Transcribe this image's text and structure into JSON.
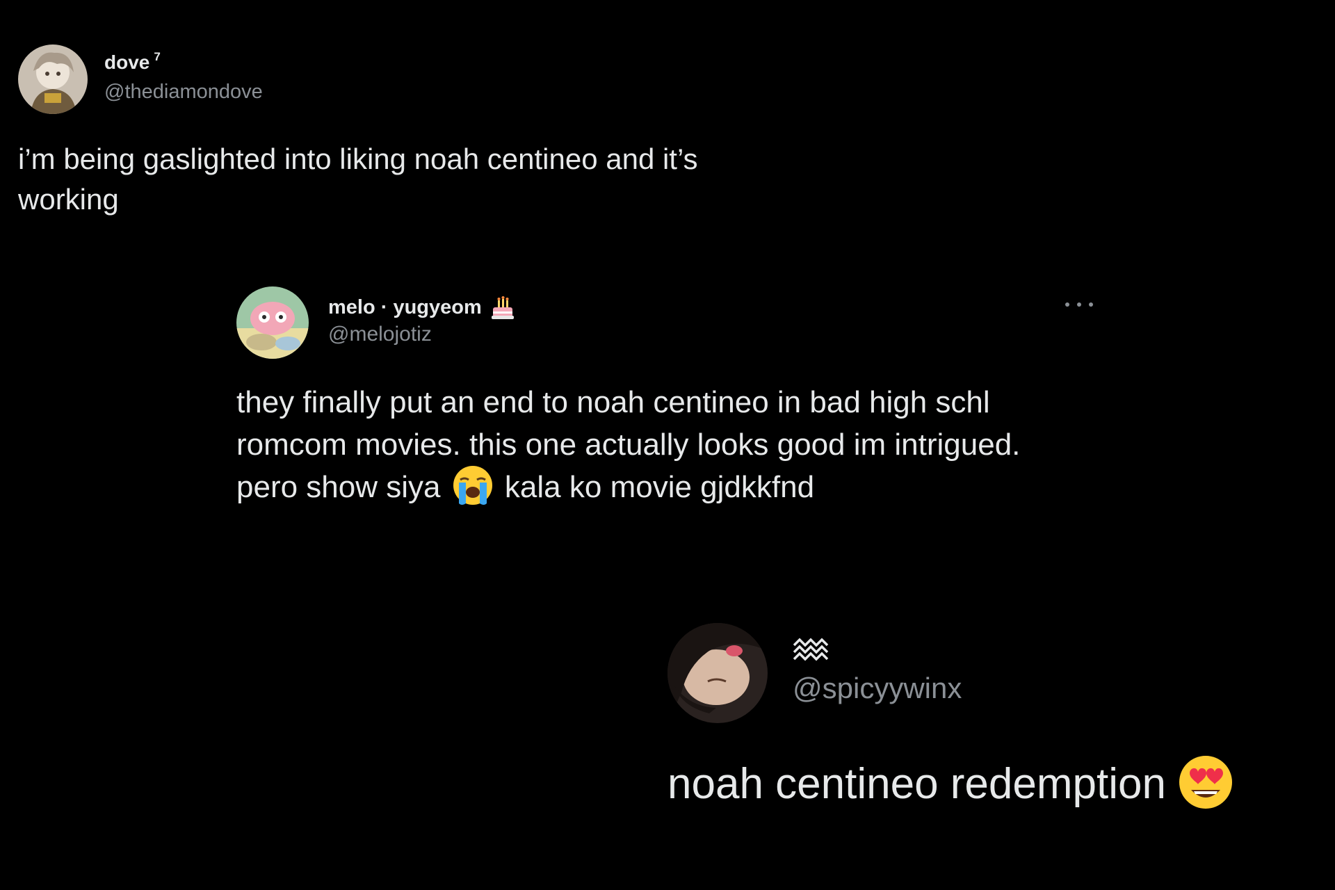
{
  "tweets": [
    {
      "display_name": "dove",
      "name_suffix": "7",
      "handle": "@thediamondove",
      "text": "i’m being gaslighted into liking noah centineo and it’s working"
    },
    {
      "display_name": "melo · yugyeom",
      "name_icon": "birthday-cake-icon",
      "handle": "@melojotiz",
      "text_before_emoji": "they finally put an end to noah centineo in bad high schl romcom movies. this one actually looks good im intrigued. pero show siya ",
      "emoji": "loudly-crying-face-icon",
      "text_after_emoji": " kala ko movie gjdkkfnd",
      "menu_icon": "more-options-icon"
    },
    {
      "name_icon": "aquarius-symbol-icon",
      "handle": "@spicyywinx",
      "text": "noah centineo redemption",
      "emoji": "heart-eyes-face-icon"
    }
  ],
  "colors": {
    "background": "#000000",
    "primary_text": "#e7e9ea",
    "secondary_text": "#8b9096"
  }
}
